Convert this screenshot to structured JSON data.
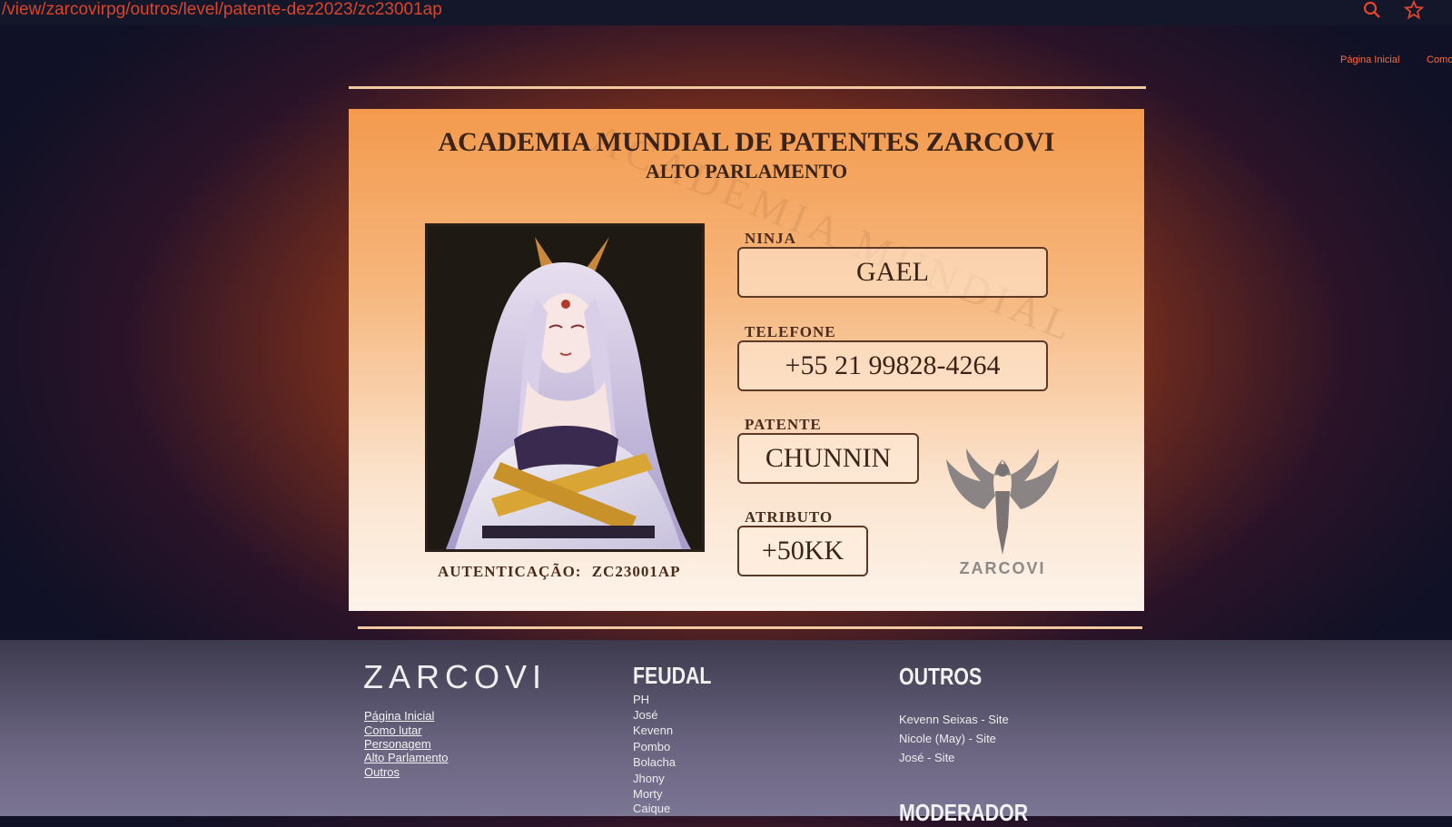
{
  "browser": {
    "url": "/view/zarcovirpg/outros/level/patente-dez2023/zc23001ap",
    "search_icon": "magnifier-icon",
    "bookmark_icon": "star-icon"
  },
  "topnav": {
    "items": [
      "Página Inicial",
      "Como"
    ]
  },
  "card": {
    "title": "ACADEMIA MUNDIAL DE PATENTES ZARCOVI",
    "subtitle": "ALTO PARLAMENTO",
    "watermark": "ACADEMIA MUNDIAL",
    "fields": {
      "ninja": {
        "label": "NINJA",
        "value": "GAEL"
      },
      "telefone": {
        "label": "TELEFONE",
        "value": "+55 21 99828-4264"
      },
      "patente": {
        "label": "PATENTE",
        "value": "CHUNNIN"
      },
      "atributo": {
        "label": "ATRIBUTO",
        "value": "+50KK"
      }
    },
    "auth_label": "AUTENTICAÇÃO:",
    "auth_code": "ZC23001AP",
    "logo_text": "ZARCOVI"
  },
  "footer": {
    "brand": "ZARCOVI",
    "links": [
      "Página Inicial",
      "Como lutar",
      "Personagem",
      "Alto Parlamento",
      "Outros"
    ],
    "feudal": {
      "title": "FEUDAL",
      "items": [
        "PH",
        "José",
        "Kevenn",
        "Pombo",
        "Bolacha",
        "Jhony",
        "Morty",
        "Caique"
      ]
    },
    "outros": {
      "title": "OUTROS",
      "items": [
        "Kevenn Seixas - Site",
        "Nicole (May) - Site",
        "José - Site"
      ]
    },
    "moderador": {
      "title": "MODERADOR"
    }
  },
  "colors": {
    "accent": "#e2452b",
    "card_top": "#f39a4e",
    "card_bottom": "#fdf3ea",
    "footer_bg": "#6a6480"
  }
}
